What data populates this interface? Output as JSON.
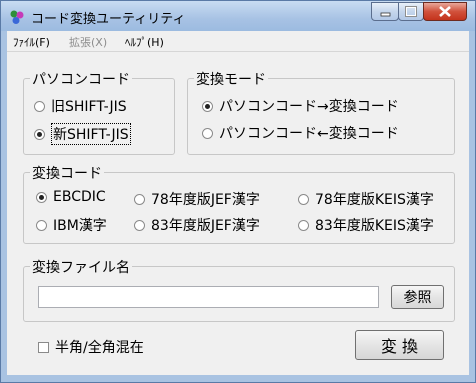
{
  "window": {
    "title": "コード変換ユーティリティ"
  },
  "menu": {
    "file": "ﾌｧｲﾙ(F)",
    "extend": "拡張(X)",
    "help": "ﾍﾙﾌﾟ(H)"
  },
  "pc_code": {
    "label": "パソコンコード",
    "options": [
      "旧SHIFT-JIS",
      "新SHIFT-JIS"
    ],
    "selected": "新SHIFT-JIS"
  },
  "mode": {
    "label": "変換モード",
    "options": [
      "パソコンコード→変換コード",
      "パソコンコード←変換コード"
    ],
    "selected": "パソコンコード→変換コード"
  },
  "conv_code": {
    "label": "変換コード",
    "options": [
      "EBCDIC",
      "78年度版JEF漢字",
      "78年度版KEIS漢字",
      "IBM漢字",
      "83年度版JEF漢字",
      "83年度版KEIS漢字"
    ],
    "selected": "EBCDIC"
  },
  "file": {
    "label": "変換ファイル名",
    "value": "",
    "browse_label": "参照"
  },
  "mixed": {
    "label": "半角/全角混在",
    "checked": false
  },
  "convert_label": "変 換"
}
